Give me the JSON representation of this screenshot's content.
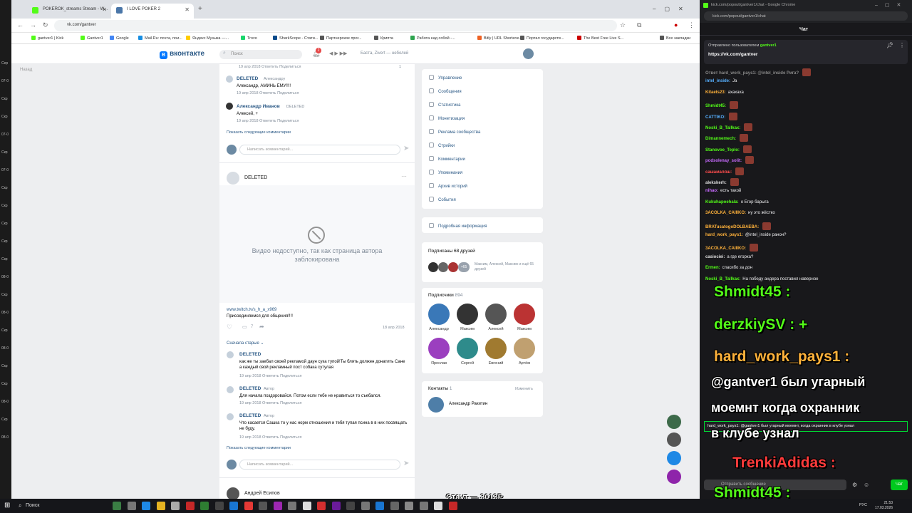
{
  "desktop": {
    "items": [
      "Сер",
      "07-0",
      "Скр",
      "Скр",
      "07-0",
      "Скр",
      "07-0",
      "Скр",
      "Скр",
      "Скр",
      "Скр",
      "Скр",
      "08-0",
      "Скр",
      "08-0",
      "Скр",
      "08-0",
      "Скр",
      "Скр",
      "08-0",
      "Скр",
      "08-0"
    ]
  },
  "browser1": {
    "tabs": [
      {
        "label": "POKEROK_streams Stream - W...",
        "color": "#53fc18"
      },
      {
        "label": "I LOVE POKER 2",
        "color": "#4a76a8"
      }
    ],
    "new_tab": "+",
    "url": "vk.com/gantver",
    "bookmarks": [
      {
        "label": "gantver1 | Kick",
        "color": "#53fc18"
      },
      {
        "label": "Gantver1",
        "color": "#53fc18"
      },
      {
        "label": "Google",
        "color": "#4285f4"
      },
      {
        "label": "Mail.Ru: почта, пои...",
        "color": "#168de2"
      },
      {
        "label": "Яндекс Музыка —...",
        "color": "#ffcc00"
      },
      {
        "label": "Trovo",
        "color": "#19d66b"
      },
      {
        "label": "SharkScope - Стати...",
        "color": "#0a4a8a"
      },
      {
        "label": "Партнерские прог...",
        "color": "#555"
      },
      {
        "label": "Крипта",
        "color": "#555"
      },
      {
        "label": "Работа над собой -...",
        "color": "#2ea44f"
      },
      {
        "label": "Bitly | URL Shortene...",
        "color": "#ee6123"
      },
      {
        "label": "Портал государств...",
        "color": "#555"
      },
      {
        "label": "The Best Free Live S...",
        "color": "#cc0000"
      },
      {
        "label": "Все закладки",
        "color": "#555"
      }
    ]
  },
  "vk": {
    "logo": "вконтакте",
    "search_placeholder": "Поиск",
    "notif_count": "2",
    "track": "Баста, Zivert — неболей",
    "back": "Назад",
    "comments_top": [
      {
        "meta": "19 апр 2018   Ответить   Поделиться",
        "likes": "1"
      },
      {
        "name": "DELETED",
        "tag": "Александру",
        "text": "Александр, АМИНЬ ЕМУ!!!!",
        "meta": "19 апр 2018   Ответить   Поделиться"
      },
      {
        "name": "Александр Иванов",
        "tag": "DELETED",
        "text": "Алексей, +",
        "meta": "19 апр 2018   Ответить   Поделиться"
      }
    ],
    "show_more": "Показать следующие комментарии",
    "comment_placeholder": "Написать комментарий...",
    "post_author": "DELETED",
    "blocked_text": "Видео недоступно, так как страница автора заблокирована",
    "post_link": "www.twitch.tv/s_h_a_x969",
    "post_text": "Присоединяемся для общения!!!!",
    "post_date": "18 апр 2018",
    "post_comments_count": "7",
    "sort_label": "Сначала старые",
    "comments_bottom": [
      {
        "name": "DELETED",
        "tag": "",
        "text": "как же ты заебал своей рекламой даун сука тупой!Ты блять должен донатить Сане а каждый свой рекламный пост собака сутулая",
        "meta": "19 апр 2018   Ответить   Поделиться"
      },
      {
        "name": "DELETED",
        "tag": "Автор",
        "text": "Для начала поздоровайся. Потом если тебе не нравиться то съебался.",
        "meta": "19 апр 2018   Ответить   Поделиться"
      },
      {
        "name": "DELETED",
        "tag": "Автор",
        "text": "Что касается Сашка то у нас норм отношения и тебя тупая псина в в них посвящать не буду.",
        "meta": "19 апр 2018   Ответить   Поделиться"
      }
    ],
    "next_author": "Андрей Есипов",
    "menu": [
      "Управление",
      "Сообщения",
      "Статистика",
      "Монетизация",
      "Реклама сообщества",
      "Стрийки",
      "Комментарии",
      "Упоминания",
      "Архив историй",
      "События"
    ],
    "more_info": "Подробная информация",
    "friends_title": "Подписаны 68 друзей",
    "friends_badge": "+65",
    "friends_names": "Максим, Алексей, Максим и ещё 65 друзей",
    "followers_title": "Подписчики",
    "followers_count": "894",
    "followers": [
      "Александр",
      "Максим",
      "Алексей",
      "Максим",
      "Ярослав",
      "Сергей",
      "Евгений",
      "Артём"
    ],
    "follower_colors": [
      "#3a78b8",
      "#333",
      "#555",
      "#b33",
      "#9b3fbf",
      "#2e8b8b",
      "#a07a30",
      "#c0a070"
    ],
    "contacts_title": "Контакты",
    "contacts_count": "1",
    "contacts_edit": "Изменить",
    "contact_name": "Александр Ракитин"
  },
  "chat": {
    "window_title": "kick.com/popout/gantver1/chat - Google Chrome",
    "url": "kick.com/popout/gantver1/chat",
    "header": "Чат",
    "pinned_by": "Отправлено пользователем",
    "pinned_user": "gantver1",
    "pinned_link": "https://vk.com/gantver",
    "messages": [
      {
        "user": "Ответ hard_work_pays1: @intel_inside Рига?",
        "text": "",
        "color": "#888"
      },
      {
        "user": "intel_inside:",
        "text": "Ja",
        "color": "#57b0ff"
      },
      {
        "user": "Kitaets23:",
        "text": "ахахаха",
        "color": "#ffb23b"
      },
      {
        "user": "Shmidt45:",
        "text": "",
        "color": "#53fc18"
      },
      {
        "user": "CATTIKO:",
        "text": "",
        "color": "#57b0ff"
      },
      {
        "user": "Noski_B_Tallkax:",
        "text": "",
        "color": "#53fc18"
      },
      {
        "user": "Dimannemech:",
        "text": "",
        "color": "#53fc18"
      },
      {
        "user": "Stanovoe_Teplo:",
        "text": "",
        "color": "#53fc18"
      },
      {
        "user": "podsolenay_solit:",
        "text": "",
        "color": "#c86bff"
      },
      {
        "user": "сашамаляш:",
        "text": "",
        "color": "#ff4d4d"
      },
      {
        "user": "alekskerh:",
        "text": "",
        "color": "#ddd"
      },
      {
        "user": "nihao:",
        "text": "есть такой",
        "color": "#c86bff"
      },
      {
        "user": "Kukuhapoehala:",
        "text": "о Егор барыга",
        "color": "#53fc18"
      },
      {
        "user": "3ACOLKA_CAIIIKO:",
        "text": "ну это жёстко",
        "color": "#ffb23b"
      },
      {
        "user": "BRATusatogoDOLBAEBA:",
        "text": "",
        "color": "#ffb23b"
      },
      {
        "user": "hard_work_pays1:",
        "text": "@intel_inside ранон?",
        "color": "#ffb23b"
      },
      {
        "user": "3ACOLKA_CAIIIKO:",
        "text": "",
        "color": "#ffb23b"
      },
      {
        "user": "casiociei:",
        "text": "а где егорка?",
        "color": "#ddd"
      },
      {
        "user": "Ermen:",
        "text": "спасибо за дон",
        "color": "#53fc18"
      },
      {
        "user": "Noski_B_Tallkax:",
        "text": "На победу андера поставил наверное",
        "color": "#53fc18"
      }
    ],
    "overlay": [
      {
        "text": "Shmidt45 :",
        "color": "#53fc18"
      },
      {
        "text": "derzkiySV : +",
        "color": "#53fc18"
      },
      {
        "text": "hard_work_pays1 :",
        "color": "#ffb23b"
      },
      {
        "text": "@gantver1 был угарный",
        "color": "#fff"
      },
      {
        "text": "моемнт когда охранник",
        "color": "#fff"
      },
      {
        "text": "в клубе узнал",
        "color": "#fff"
      },
      {
        "text": "TrenkiAdidas :",
        "color": "#ff3b3b"
      },
      {
        "text": "Shmidt45 :",
        "color": "#53fc18"
      }
    ],
    "highlight_msg": "hard_work_pays1: @gantver1 был угарный моемнт, когда охранник в клубе узнал",
    "input_placeholder": "Отправить сообщение",
    "send_label": "Чат"
  },
  "stream_overlay": "Стаут — 3013Р",
  "taskbar": {
    "search": "Поиск",
    "lang": "РУС",
    "time": "21:53",
    "date": "17.03.2026"
  }
}
